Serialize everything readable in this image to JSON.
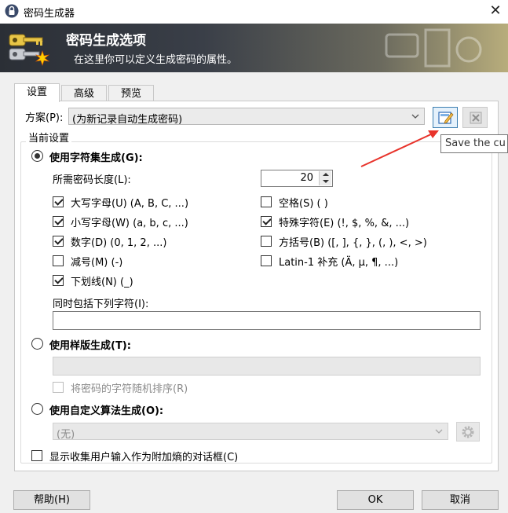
{
  "window": {
    "title": "密码生成器",
    "close_glyph": "✕"
  },
  "banner": {
    "title": "密码生成选项",
    "subtitle": "在这里你可以定义生成密码的属性。"
  },
  "tabs": [
    {
      "label": "设置"
    },
    {
      "label": "高级"
    },
    {
      "label": "预览"
    }
  ],
  "profile": {
    "label": "方案(P):",
    "value": "(为新记录自动生成密码)",
    "tooltip": "Save the cu"
  },
  "current_settings": {
    "group_label": "当前设置",
    "charset_radio": "使用字符集生成(G):",
    "length_label": "所需密码长度(L):",
    "length_value": "20",
    "charsets": [
      {
        "label": "大写字母(U) (A, B, C, ...)",
        "checked": true
      },
      {
        "label": "空格(S) ( )",
        "checked": false
      },
      {
        "label": "小写字母(W) (a, b, c, ...)",
        "checked": true
      },
      {
        "label": "特殊字符(E) (!, $, %, &, ...)",
        "checked": true
      },
      {
        "label": "数字(D) (0, 1, 2, ...)",
        "checked": true
      },
      {
        "label": "方括号(B) ([, ], {, }, (, ), <, >)",
        "checked": false
      },
      {
        "label": "减号(M) (-)",
        "checked": false
      },
      {
        "label": "Latin-1 补充 (Ä, µ, ¶, ...)",
        "checked": false
      },
      {
        "label": "下划线(N) (_)",
        "checked": true
      }
    ],
    "include_label": "同时包括下列字符(I):",
    "include_value": "",
    "pattern_radio": "使用样版生成(T):",
    "pattern_value": "",
    "shuffle_label": "将密码的字符随机排序(R)",
    "custom_radio": "使用自定义算法生成(O):",
    "custom_value": "(无)",
    "entropy_label": "显示收集用户输入作为附加熵的对话框(C)"
  },
  "buttons": {
    "help": "帮助(H)",
    "ok": "OK",
    "cancel": "取消"
  },
  "colors": {
    "accent_arrow": "#e8332b",
    "focus_border": "#3c7fb1"
  }
}
